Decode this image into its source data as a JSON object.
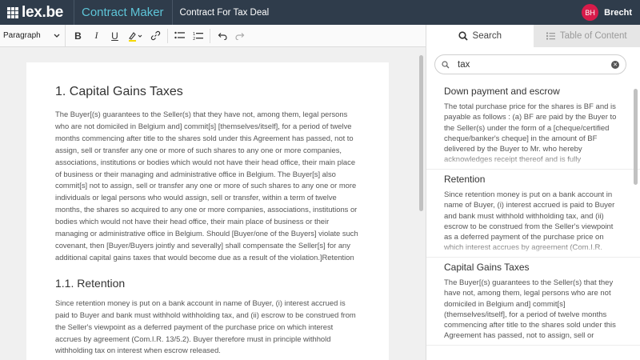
{
  "header": {
    "logo_text": "lex.be",
    "app_name": "Contract Maker",
    "doc_title": "Contract For Tax Deal",
    "user_initials": "BH",
    "user_name": "Brecht"
  },
  "toolbar": {
    "block_format": "Paragraph",
    "bold": "B",
    "italic": "I",
    "underline": "U"
  },
  "document": {
    "heading1": "1. Capital Gains Taxes",
    "paragraph1": "The Buyer[(s) guarantees to the Seller(s) that they have not, among them, legal persons who are not domiciled in Belgium and] commit[s] [themselves/itself], for a period of twelve months commencing after title to the shares sold under this Agreement has passed, not to assign, sell or transfer any one or more of such shares to any one or more companies, associations, institutions or bodies which would not have their head office, their main place of business or their managing and administrative office in Belgium. The Buyer[s] also commit[s] not to assign, sell or transfer any one or more of such shares to any one or more individuals or legal persons who would assign, sell or transfer, within a term of twelve months, the shares so acquired to any one or more companies, associations, institutions or bodies which would not have their head office, their main place of business or their managing or administrative office in Belgium. Should [Buyer/one of the Buyers] violate such covenant, then [Buyer/Buyers jointly and severally] shall compensate the Seller[s] for any additional capital gains taxes that would become due as a result of the violation.]Retention",
    "heading2": "1.1. Retention",
    "paragraph2": "Since retention money is put on a bank account in name of Buyer, (i) interest accrued is paid to Buyer and bank must withhold withholding tax, and (ii) escrow to be construed from the Seller's viewpoint as a deferred payment of the purchase price on which interest accrues by agreement (Com.I.R. 13/5.2). Buyer therefore must in principle withhold withholding tax on interest when escrow released."
  },
  "panel": {
    "tabs": [
      {
        "label": "Search",
        "icon": "search-icon",
        "active": true
      },
      {
        "label": "Table of Content",
        "icon": "list-icon",
        "active": false
      }
    ],
    "search_value": "tax",
    "results": [
      {
        "title": "Down payment and escrow",
        "text": "The total purchase price for the shares is BF and is payable as follows : (a) BF are paid by the Buyer to the Seller(s) under the form of a [cheque/certified cheque/banker's cheque] in the amount of BF delivered by the Buyer to Mr. who hereby acknowledges receipt thereof and is fully"
      },
      {
        "title": "Retention",
        "text": "Since retention money is put on a bank account in name of Buyer, (i) interest accrued is paid to Buyer and bank must withhold withholding tax, and (ii) escrow to be construed from the Seller's viewpoint as a deferred payment of the purchase price on which interest accrues by agreement (Com.I.R."
      },
      {
        "title": "Capital Gains Taxes",
        "text": "The Buyer[(s) guarantees to the Seller(s) that they have not, among them, legal persons who are not domiciled in Belgium and] commit[s] (themselves/itself], for a period of twelve months commencing after title to the shares sold under this Agreement has passed, not to assign, sell or"
      }
    ]
  },
  "colors": {
    "header_bg": "#2f3c4b",
    "accent": "#5ec5d8",
    "avatar": "#d81b4a"
  }
}
